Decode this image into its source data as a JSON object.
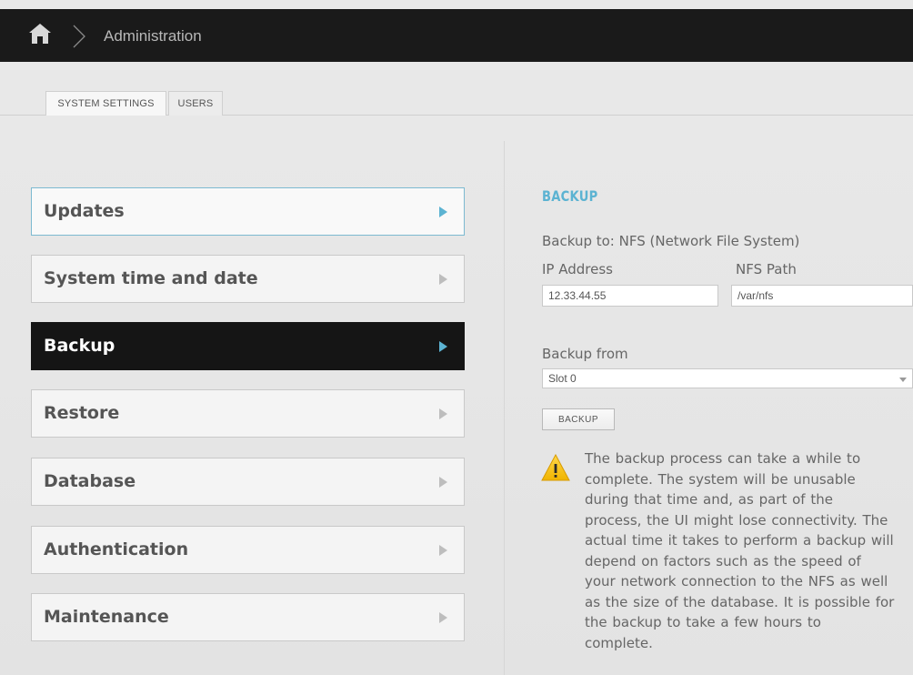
{
  "header": {
    "home_icon": "home-icon",
    "separator_icon": "chevron-right-icon",
    "breadcrumb_title": "Administration"
  },
  "tabs": [
    {
      "label": "SYSTEM SETTINGS",
      "active": true
    },
    {
      "label": "USERS",
      "active": false
    }
  ],
  "menu": {
    "items": [
      {
        "label": "Updates",
        "state": "highlighted"
      },
      {
        "label": "System time and date",
        "state": "normal"
      },
      {
        "label": "Backup",
        "state": "selected"
      },
      {
        "label": "Restore",
        "state": "normal"
      },
      {
        "label": "Database",
        "state": "normal"
      },
      {
        "label": "Authentication",
        "state": "normal"
      },
      {
        "label": "Maintenance",
        "state": "normal"
      }
    ]
  },
  "backup": {
    "title": "BACKUP",
    "backup_to": "Backup to: NFS (Network File System)",
    "ip_label": "IP Address",
    "ip_value": "12.33.44.55",
    "nfs_label": "NFS Path",
    "nfs_value": "/var/nfs",
    "from_label": "Backup from",
    "from_value": "Slot 0",
    "button_label": "BACKUP",
    "warning_icon": "warning-icon",
    "warning_lines": [
      "The backup process can take a while to",
      "complete. The system will be unusable",
      "during that time and, as part of the",
      "process, the UI might lose connectivity. The",
      "actual time it takes to perform a backup will",
      "depend on factors such as the speed of",
      "your network connection to the NFS as well",
      "as the size of the database. It is possible for",
      "the backup to take a few hours to",
      "complete."
    ]
  },
  "colors": {
    "topbar": "#1a1a1a",
    "accent": "#5cb3d2",
    "selected_item": "#151515",
    "warning": "#f5c000"
  }
}
